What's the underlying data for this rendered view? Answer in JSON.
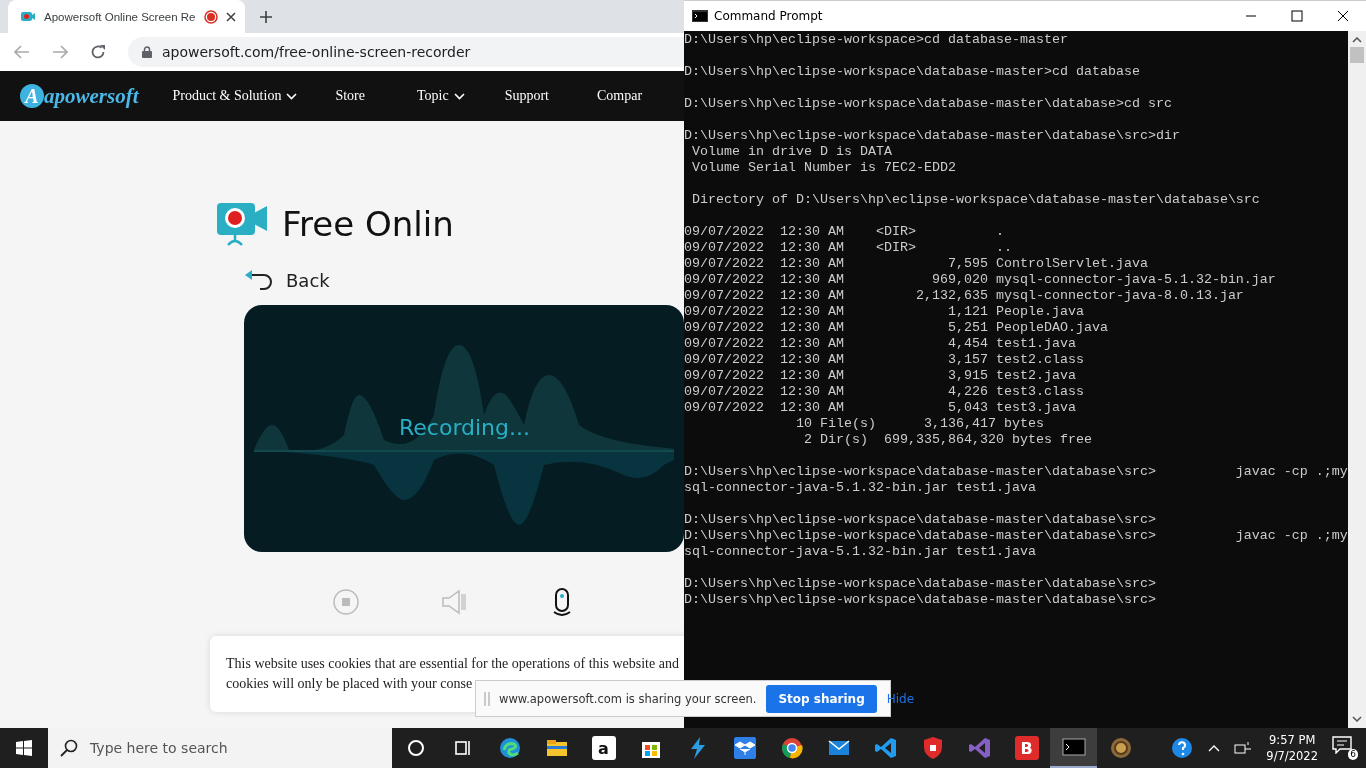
{
  "browser": {
    "tab": {
      "title": "Apowersoft Online Screen Re",
      "recording": true
    },
    "address": "apowersoft.com/free-online-screen-recorder",
    "site_nav": {
      "logo": {
        "mark": "A",
        "name": "apowersoft"
      },
      "items": [
        {
          "label": "Product & Solution",
          "dropdown": true
        },
        {
          "label": "Store",
          "dropdown": false
        },
        {
          "label": "Topic",
          "dropdown": true
        },
        {
          "label": "Support",
          "dropdown": false
        },
        {
          "label": "Compar",
          "dropdown": false
        }
      ]
    },
    "heading": "Free Onlin",
    "back": "Back",
    "status": "Recording...",
    "sources": [
      {
        "kind": "webcam",
        "selected": false
      },
      {
        "kind": "speaker",
        "selected": false
      },
      {
        "kind": "microphone",
        "selected": true
      }
    ],
    "cookie_notice": [
      "This website uses cookies that are essential for the operations of this website and",
      "cookies will only be placed with your conse"
    ]
  },
  "share_bar": {
    "message": "www.apowersoft.com is sharing your screen.",
    "stop": "Stop sharing",
    "hide": "Hide"
  },
  "console": {
    "title": "Command Prompt",
    "blocks": [
      [
        "D:\\Users\\hp\\eclipse-workspace>cd database-master"
      ],
      [
        "D:\\Users\\hp\\eclipse-workspace\\database-master>cd database"
      ],
      [
        "D:\\Users\\hp\\eclipse-workspace\\database-master\\database>cd src"
      ],
      [
        "D:\\Users\\hp\\eclipse-workspace\\database-master\\database\\src>dir",
        " Volume in drive D is DATA",
        " Volume Serial Number is 7EC2-EDD2"
      ],
      [
        " Directory of D:\\Users\\hp\\eclipse-workspace\\database-master\\database\\src"
      ],
      [
        "09/07/2022  12:30 AM    <DIR>          .",
        "09/07/2022  12:30 AM    <DIR>          ..",
        "09/07/2022  12:30 AM             7,595 ControlServlet.java",
        "09/07/2022  12:30 AM           969,020 mysql-connector-java-5.1.32-bin.jar",
        "09/07/2022  12:30 AM         2,132,635 mysql-connector-java-8.0.13.jar",
        "09/07/2022  12:30 AM             1,121 People.java",
        "09/07/2022  12:30 AM             5,251 PeopleDAO.java",
        "09/07/2022  12:30 AM             4,454 test1.java",
        "09/07/2022  12:30 AM             3,157 test2.class",
        "09/07/2022  12:30 AM             3,915 test2.java",
        "09/07/2022  12:30 AM             4,226 test3.class",
        "09/07/2022  12:30 AM             5,043 test3.java",
        "              10 File(s)      3,136,417 bytes",
        "               2 Dir(s)  699,335,864,320 bytes free"
      ],
      [
        "D:\\Users\\hp\\eclipse-workspace\\database-master\\database\\src>          javac -cp .;my",
        "sql-connector-java-5.1.32-bin.jar test1.java"
      ],
      [
        "D:\\Users\\hp\\eclipse-workspace\\database-master\\database\\src>",
        "D:\\Users\\hp\\eclipse-workspace\\database-master\\database\\src>          javac -cp .;my",
        "sql-connector-java-5.1.32-bin.jar test1.java"
      ],
      [
        "D:\\Users\\hp\\eclipse-workspace\\database-master\\database\\src>",
        "D:\\Users\\hp\\eclipse-workspace\\database-master\\database\\src>"
      ]
    ]
  },
  "taskbar": {
    "search_placeholder": "Type here to search",
    "apps": [
      {
        "kind": "cortana",
        "selected": false
      },
      {
        "kind": "taskview",
        "selected": false
      },
      {
        "kind": "edge",
        "selected": false
      },
      {
        "kind": "explorer",
        "selected": false
      },
      {
        "kind": "amazon",
        "selected": false,
        "label": "a"
      },
      {
        "kind": "store",
        "selected": false
      },
      {
        "kind": "lightning",
        "selected": false
      },
      {
        "kind": "dropbox",
        "selected": false
      },
      {
        "kind": "chrome",
        "selected": false
      },
      {
        "kind": "mail",
        "selected": false
      },
      {
        "kind": "vscode",
        "selected": false
      },
      {
        "kind": "shield",
        "selected": false
      },
      {
        "kind": "vstudio",
        "selected": false
      },
      {
        "kind": "letter",
        "selected": false,
        "label": "B"
      },
      {
        "kind": "terminal",
        "selected": true
      },
      {
        "kind": "game",
        "selected": false
      }
    ],
    "time": "9:57 PM",
    "date": "9/7/2022",
    "notifications": "6"
  }
}
